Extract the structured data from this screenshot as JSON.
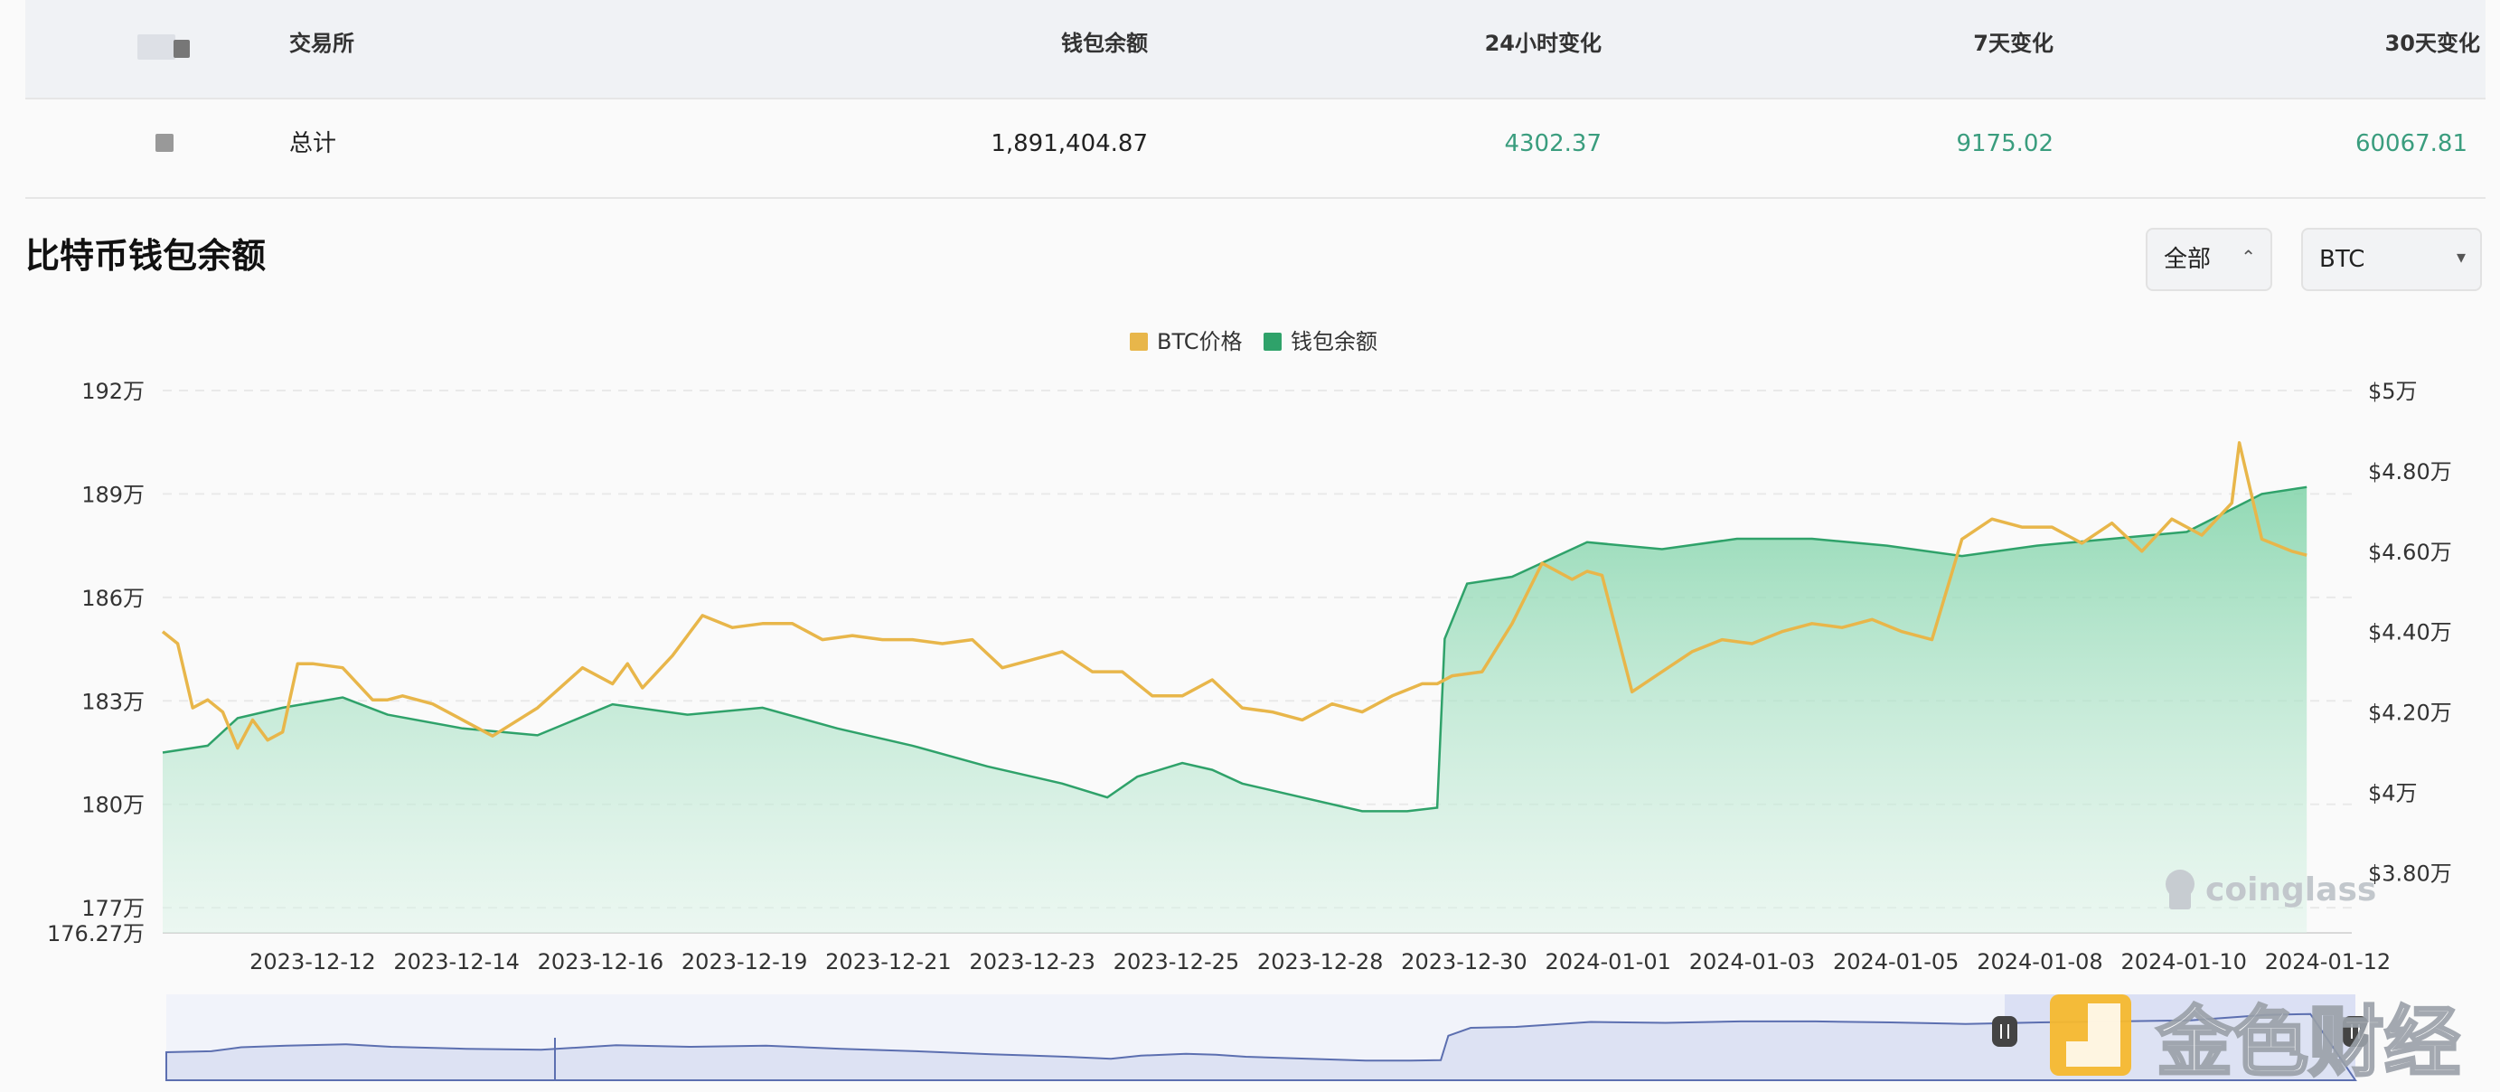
{
  "table": {
    "headers": [
      "交易所",
      "钱包余额",
      "24小时变化",
      "7天变化",
      "30天变化"
    ],
    "total_row": {
      "label": "总计",
      "wallet_balance": "1,891,404.87",
      "change_24h": "4302.37",
      "change_7d": "9175.02",
      "change_30d": "60067.81"
    }
  },
  "section": {
    "title": "比特币钱包余额",
    "range_select": "全部",
    "coin_select": "BTC"
  },
  "colors": {
    "price_line": "#e8b64a",
    "balance_line": "#2fa26a",
    "balance_fill": "#7fd3a8",
    "positive_text": "#3a9d7e",
    "navigator": "#c9d0ee"
  },
  "icons": {
    "range_select": "updown-chevron-icon",
    "coin_select": "caret-down-icon",
    "watermark_logo": "coinglass-logo-icon",
    "brand_logo": "jinse-logo-icon"
  },
  "watermarks": {
    "chart": "coinglass",
    "corner": "金色财经"
  },
  "chart_data": {
    "type": "line",
    "title": "比特币钱包余额",
    "legend": [
      "BTC价格",
      "钱包余额"
    ],
    "legend_position": "top-center",
    "x_tick_labels": [
      "2023-12-12",
      "2023-12-14",
      "2023-12-16",
      "2023-12-19",
      "2023-12-21",
      "2023-12-23",
      "2023-12-25",
      "2023-12-28",
      "2023-12-30",
      "2024-01-01",
      "2024-01-03",
      "2024-01-05",
      "2024-01-08",
      "2024-01-10",
      "2024-01-12"
    ],
    "y_left": {
      "ticks": [
        "192万",
        "189万",
        "186万",
        "183万",
        "180万",
        "177万",
        "176.27万"
      ],
      "tick_values": [
        1920000,
        1890000,
        1860000,
        1830000,
        1800000,
        1770000,
        1762700
      ],
      "range": [
        1762700,
        1920000
      ]
    },
    "y_right": {
      "ticks": [
        "$5万",
        "$4.80万",
        "$4.60万",
        "$4.40万",
        "$4.20万",
        "$4万",
        "$3.80万"
      ],
      "tick_values": [
        50000,
        48000,
        46000,
        44000,
        42000,
        40000,
        38000
      ],
      "range": [
        36500,
        50000
      ]
    },
    "grid": true,
    "series": [
      {
        "name": "钱包余额",
        "axis": "left",
        "style": "area",
        "x": [
          0,
          0.3,
          0.5,
          0.8,
          1.2,
          1.5,
          2.0,
          2.5,
          3.0,
          3.5,
          4.0,
          4.5,
          5.0,
          5.5,
          6.0,
          6.3,
          6.5,
          6.8,
          7.0,
          7.2,
          7.5,
          8.0,
          8.3,
          8.5,
          8.55,
          8.7,
          9.0,
          9.5,
          10.0,
          10.5,
          11.0,
          11.5,
          12.0,
          12.5,
          13.0,
          13.5,
          14.0,
          14.3
        ],
        "values": [
          1815000,
          1817000,
          1825000,
          1828000,
          1831000,
          1826000,
          1822000,
          1820000,
          1829000,
          1826000,
          1828000,
          1822000,
          1817000,
          1811000,
          1806000,
          1802000,
          1808000,
          1812000,
          1810000,
          1806000,
          1803000,
          1798000,
          1798000,
          1799000,
          1848000,
          1864000,
          1866000,
          1876000,
          1874000,
          1877000,
          1877000,
          1875000,
          1872000,
          1875000,
          1877000,
          1879000,
          1890000,
          1892000
        ]
      },
      {
        "name": "BTC价格",
        "axis": "right",
        "style": "line",
        "x": [
          0,
          0.1,
          0.2,
          0.3,
          0.4,
          0.5,
          0.6,
          0.7,
          0.8,
          0.9,
          1.0,
          1.2,
          1.4,
          1.5,
          1.6,
          1.8,
          2.0,
          2.2,
          2.5,
          2.8,
          3.0,
          3.1,
          3.2,
          3.4,
          3.6,
          3.8,
          4.0,
          4.2,
          4.4,
          4.6,
          4.8,
          5.0,
          5.2,
          5.4,
          5.6,
          5.8,
          6.0,
          6.2,
          6.4,
          6.6,
          6.8,
          7.0,
          7.2,
          7.4,
          7.6,
          7.8,
          8.0,
          8.2,
          8.4,
          8.5,
          8.6,
          8.8,
          9.0,
          9.2,
          9.4,
          9.5,
          9.6,
          9.8,
          10.0,
          10.2,
          10.4,
          10.6,
          10.8,
          11.0,
          11.2,
          11.4,
          11.6,
          11.8,
          12.0,
          12.2,
          12.4,
          12.6,
          12.8,
          13.0,
          13.2,
          13.4,
          13.6,
          13.8,
          13.85,
          14.0,
          14.2,
          14.3
        ],
        "values": [
          44000,
          43700,
          42100,
          42300,
          42000,
          41100,
          41800,
          41300,
          41500,
          43200,
          43200,
          43100,
          42300,
          42300,
          42400,
          42200,
          41800,
          41400,
          42100,
          43100,
          42700,
          43200,
          42600,
          43400,
          44400,
          44100,
          44200,
          44200,
          43800,
          43900,
          43800,
          43800,
          43700,
          43800,
          43100,
          43300,
          43500,
          43000,
          43000,
          42400,
          42400,
          42800,
          42100,
          42000,
          41800,
          42200,
          42000,
          42400,
          42700,
          42700,
          42900,
          43000,
          44200,
          45700,
          45300,
          45500,
          45400,
          42500,
          43000,
          43500,
          43800,
          43700,
          44000,
          44200,
          44100,
          44300,
          44000,
          43800,
          46300,
          46800,
          46600,
          46600,
          46200,
          46700,
          46000,
          46800,
          46400,
          47200,
          48700,
          46300,
          46000,
          45900
        ]
      }
    ],
    "navigator": {
      "present": true,
      "selected_range": "end",
      "handle_icon": "pause-handle-icon"
    }
  }
}
